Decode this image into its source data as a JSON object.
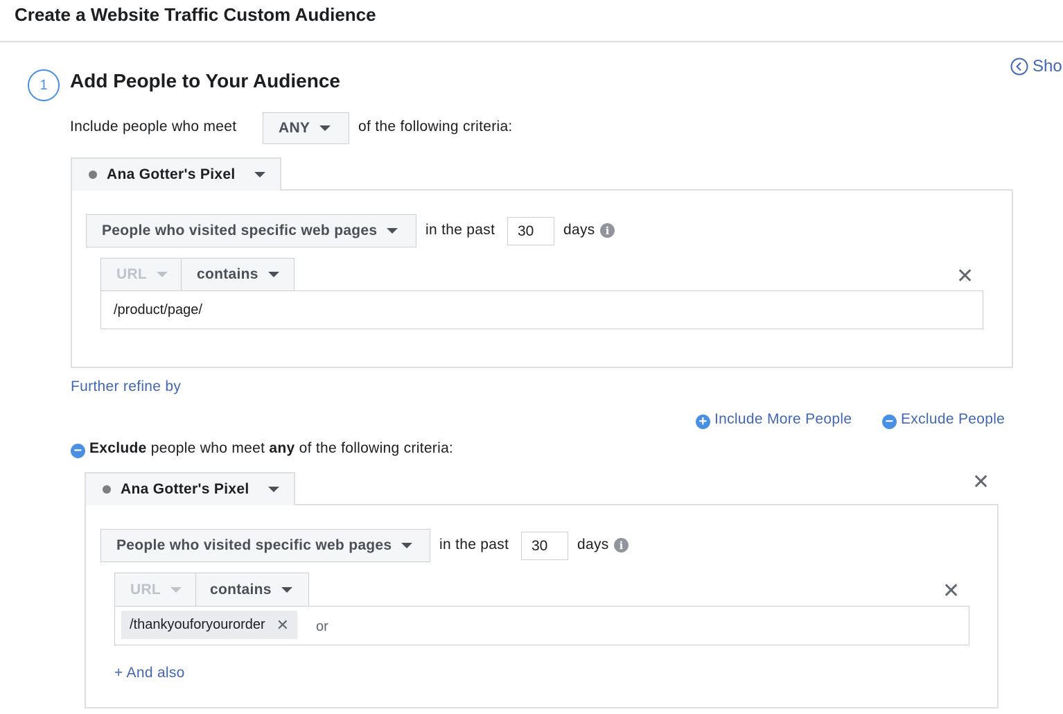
{
  "header": {
    "title": "Create a Website Traffic Custom Audience"
  },
  "side_link": {
    "label": "Sho"
  },
  "step": {
    "number": "1",
    "title": "Add People to Your Audience"
  },
  "include": {
    "prefix": "Include people who meet",
    "match_value": "ANY",
    "suffix": "of the following criteria:",
    "pixel": "Ana Gotter's Pixel",
    "event": "People who visited specific web pages",
    "in_the_past": "in the past",
    "days_value": "30",
    "days_label": "days",
    "url_field": "URL",
    "operator": "contains",
    "url_value": "/product/page/"
  },
  "further_refine": "Further refine by",
  "actions": {
    "include_more": "Include More People",
    "exclude": "Exclude People"
  },
  "exclude": {
    "label_bold": "Exclude",
    "label_mid": "people who meet",
    "label_any": "any",
    "label_end": "of the following criteria:",
    "pixel": "Ana Gotter's Pixel",
    "event": "People who visited specific web pages",
    "in_the_past": "in the past",
    "days_value": "30",
    "days_label": "days",
    "url_field": "URL",
    "operator": "contains",
    "tag_value": "/thankyouforyourorder",
    "or_text": "or",
    "and_also": "+ And also"
  },
  "icons": {
    "close": "close-icon",
    "info": "info-icon",
    "plus": "plus-circle-icon",
    "minus": "minus-circle-icon",
    "back": "chevron-left-circle-icon"
  },
  "colors": {
    "link": "#4267b2",
    "accent": "#4a90e2",
    "border": "#dddfe2",
    "button_bg": "#f5f6f7"
  }
}
